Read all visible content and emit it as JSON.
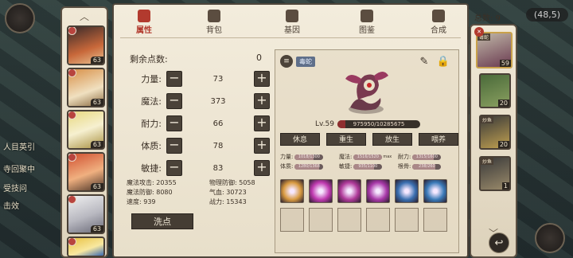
{
  "coord": "(48,5)",
  "background_texts": [
    "人目英引",
    "寺回聚中",
    "受技问",
    "击效"
  ],
  "tabs": [
    {
      "label": "属性",
      "active": true
    },
    {
      "label": "背包",
      "active": false
    },
    {
      "label": "基因",
      "active": false
    },
    {
      "label": "图鉴",
      "active": false
    },
    {
      "label": "合成",
      "active": false
    }
  ],
  "points": {
    "label": "剩余点数:",
    "value": "0"
  },
  "stats": [
    {
      "name": "力量:",
      "value": "73"
    },
    {
      "name": "魔法:",
      "value": "373"
    },
    {
      "name": "耐力:",
      "value": "66"
    },
    {
      "name": "体质:",
      "value": "78"
    },
    {
      "name": "敏捷:",
      "value": "83"
    }
  ],
  "combat": {
    "magic_attack": "魔法攻击: 20355",
    "physical_defense": "物理防御: 5058",
    "magic_defense": "魔法防御: 8080",
    "qi_blood": "气血: 30723",
    "speed": "速度: 939",
    "power": "战力: 15343"
  },
  "reset_label": "洗点",
  "pet": {
    "name": "毒蛇",
    "level_label": "Lv.59",
    "exp_text": "975950/10285675",
    "exp_fraction": 0.095,
    "actions": [
      "休息",
      "重生",
      "放生",
      "喂养"
    ],
    "aptitudes": [
      [
        {
          "label": "力量:",
          "fraction": 0.65,
          "text": "1018/1300"
        },
        {
          "label": "魔法:",
          "fraction": 1.0,
          "text": "1516/1520"
        },
        {
          "label": "耐力:",
          "fraction": 0.75,
          "text": "1315/1600"
        }
      ],
      [
        {
          "label": "体质:",
          "fraction": 0.85,
          "text": "1280/1368"
        },
        {
          "label": "敏捷:",
          "fraction": 0.7,
          "text": "935/1100"
        },
        {
          "label": "根骨:",
          "fraction": 0.8,
          "text": "238/260"
        }
      ]
    ],
    "max_label": "max"
  },
  "skills": [
    {
      "name": "skill-1",
      "color": "#d89a40"
    },
    {
      "name": "skill-2",
      "color": "#c03ab0"
    },
    {
      "name": "skill-3",
      "color": "#b03a9a"
    },
    {
      "name": "skill-4",
      "color": "#a838a8"
    },
    {
      "name": "skill-5",
      "color": "#3a6fb0"
    },
    {
      "name": "skill-6",
      "color": "#3a7ab8"
    }
  ],
  "heroes": [
    "63",
    "63",
    "63",
    "63",
    "63",
    "63"
  ],
  "pet_list": {
    "total_label": "总数: 9",
    "items": [
      {
        "tag": "毒蛇",
        "level": "59"
      },
      {
        "tag": "",
        "level": "20"
      },
      {
        "tag": "炒鱼",
        "level": "20"
      },
      {
        "tag": "炒鱼",
        "level": "1"
      }
    ]
  }
}
